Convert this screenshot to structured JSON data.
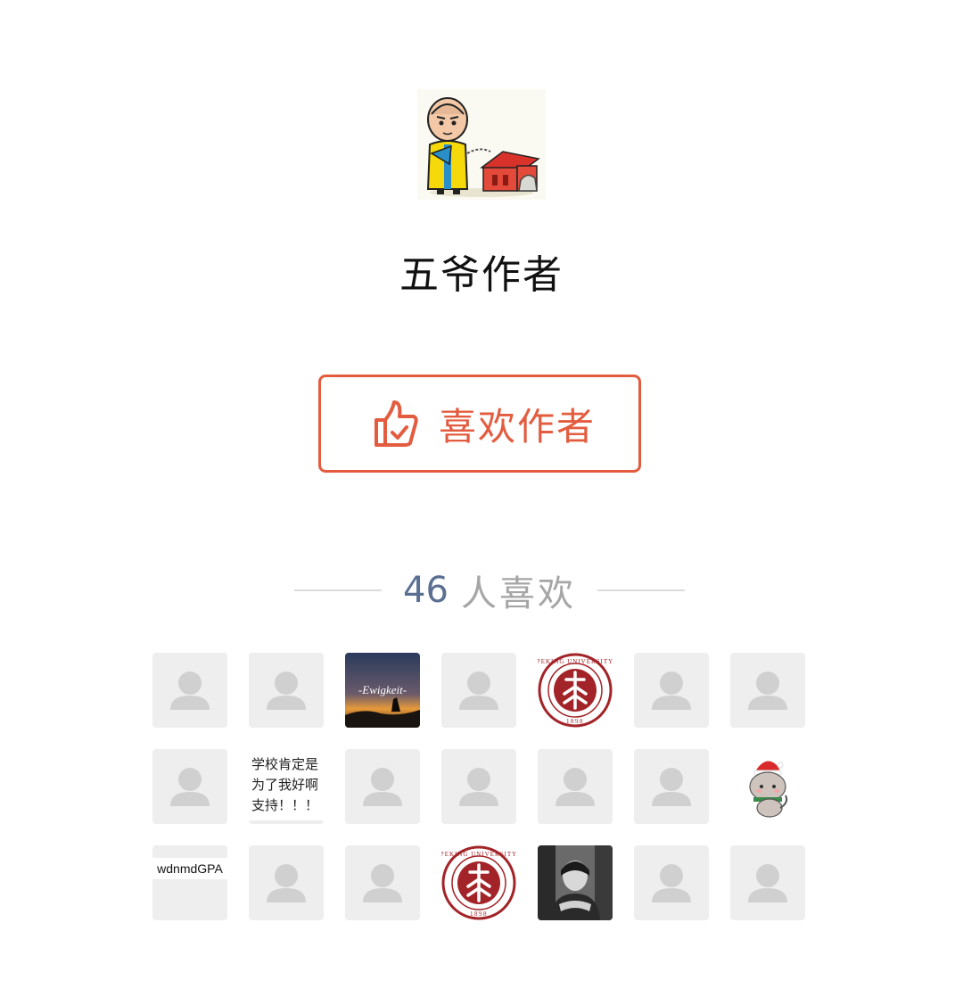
{
  "author": {
    "name": "五爷作者",
    "avatar_icon": "cartoon-monk-avatar"
  },
  "like_button": {
    "label": "喜欢作者",
    "icon": "thumbs-up-icon",
    "color": "#e35c3f"
  },
  "likes": {
    "count": "46",
    "label": "人喜欢",
    "count_color": "#5a6f92"
  },
  "likers": [
    {
      "type": "default"
    },
    {
      "type": "default"
    },
    {
      "type": "image",
      "icon": "sunset-ewigkeit-avatar",
      "text": "-Ewigkeit-"
    },
    {
      "type": "default"
    },
    {
      "type": "image",
      "icon": "peking-university-seal-avatar",
      "ring_text": "PEKING UNIVERSITY",
      "year": "1898"
    },
    {
      "type": "default"
    },
    {
      "type": "default"
    },
    {
      "type": "default"
    },
    {
      "type": "text",
      "text": "学校肯定是为了我好啊支持！！！"
    },
    {
      "type": "default"
    },
    {
      "type": "default"
    },
    {
      "type": "default"
    },
    {
      "type": "default"
    },
    {
      "type": "image",
      "icon": "christmas-cat-avatar"
    },
    {
      "type": "tag",
      "text": "wdnmdGPA"
    },
    {
      "type": "default"
    },
    {
      "type": "default"
    },
    {
      "type": "image",
      "icon": "peking-university-seal-avatar",
      "ring_text": "PEKING UNIVERSITY",
      "year": "1898"
    },
    {
      "type": "image",
      "icon": "portrait-photo-avatar"
    },
    {
      "type": "default"
    },
    {
      "type": "default"
    }
  ]
}
